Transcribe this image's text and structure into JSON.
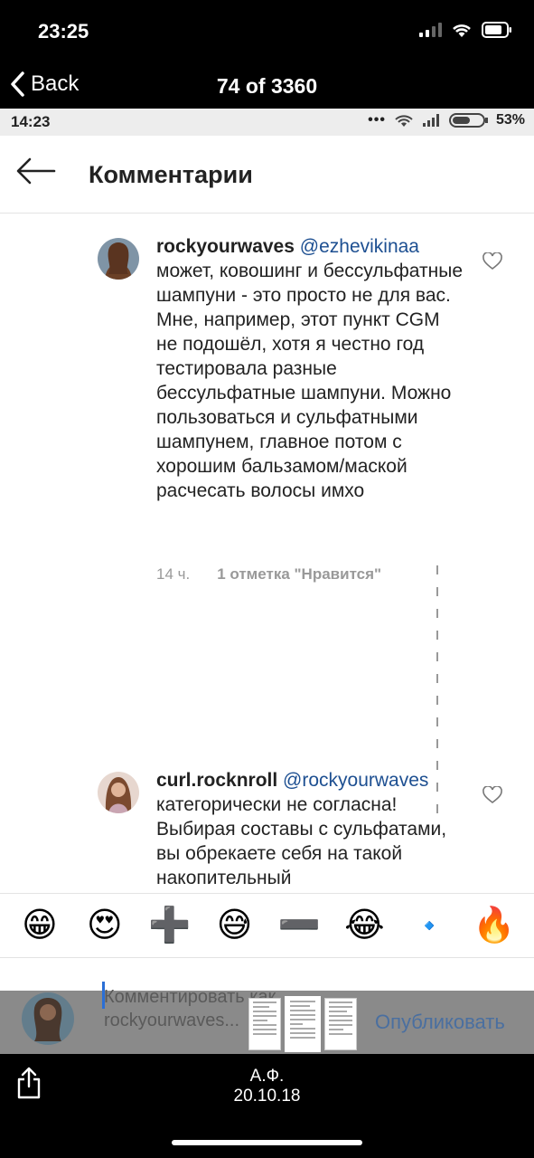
{
  "ios_status": {
    "time": "23:25"
  },
  "viewer": {
    "back_label": "Back",
    "counter": "74 of 3360",
    "caption_name": "А.Ф.",
    "caption_date": "20.10.18"
  },
  "android_status": {
    "time": "14:23",
    "dots": "•••",
    "battery": "53%"
  },
  "header": {
    "title": "Комментарии"
  },
  "comments": [
    {
      "username": "rockyourwaves",
      "mention": "@ezhevikinaa",
      "text": "может, ковошинг и бессульфатные шампуни - это просто не для вас. Мне, например, этот пункт CGM не подошёл, хотя я честно год тестировала разные бессульфатные шампуни. Можно пользоваться и сульфатными шампунем, главное потом с хорошим бальзамом/маской расчесать волосы имхо",
      "time": "14 ч.",
      "likes": "1 отметка \"Нравится\""
    },
    {
      "username": "curl.rocknroll",
      "mention": "@rockyourwaves",
      "text": "категорически не согласна! Выбирая составы с сульфатами, вы обрекаете себя на такой накопительный"
    }
  ],
  "emoji_bar": [
    "😁",
    "😍",
    "➕",
    "😅",
    "➖",
    "😂",
    "🔹",
    "🔥"
  ],
  "input": {
    "placeholder": "Комментировать как rockyourwaves...",
    "publish_label": "Опубликовать"
  },
  "colors": {
    "link": "#1d4f91",
    "background": "#000000",
    "accent": "#2b6fd6"
  }
}
